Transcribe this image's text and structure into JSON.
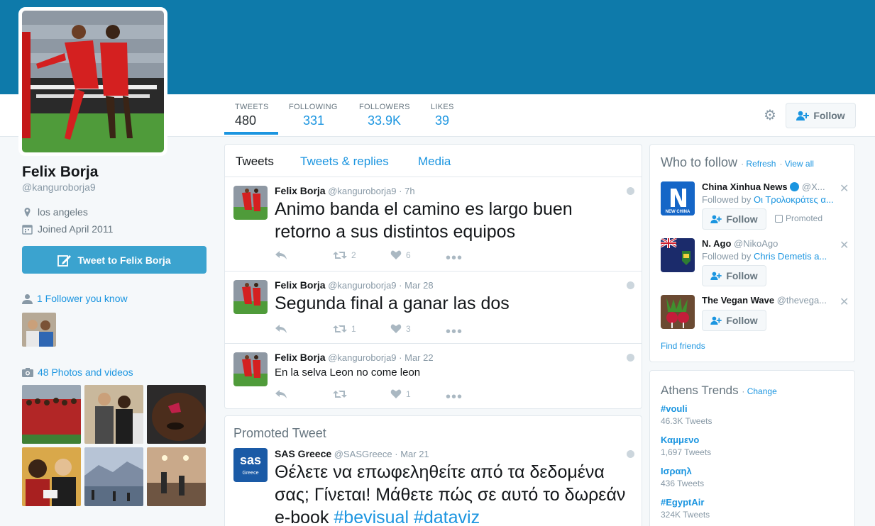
{
  "profile": {
    "name": "Felix Borja",
    "handle": "@kanguroborja9",
    "location": "los angeles",
    "joined": "Joined April 2011",
    "tweet_to_label": "Tweet to Felix Borja",
    "followers_you_know": "1 Follower you know",
    "photos_videos": "48 Photos and videos"
  },
  "nav": {
    "stats": [
      {
        "label": "TWEETS",
        "value": "480"
      },
      {
        "label": "FOLLOWING",
        "value": "331"
      },
      {
        "label": "FOLLOWERS",
        "value": "33.9K"
      },
      {
        "label": "LIKES",
        "value": "39"
      }
    ],
    "follow_label": "Follow"
  },
  "timeline": {
    "tabs": [
      "Tweets",
      "Tweets & replies",
      "Media"
    ],
    "tweets": [
      {
        "name": "Felix Borja",
        "handle": "@kanguroborja9",
        "time": "7h",
        "text": "Animo banda   el camino es largo  buen retorno a sus distintos equipos",
        "retweets": "2",
        "likes": "6"
      },
      {
        "name": "Felix Borja",
        "handle": "@kanguroborja9",
        "time": "Mar 28",
        "text": "Segunda final  a ganar las dos",
        "retweets": "1",
        "likes": "3"
      },
      {
        "name": "Felix Borja",
        "handle": "@kanguroborja9",
        "time": "Mar 22",
        "text": "En la selva Leon no come leon",
        "retweets": "",
        "likes": "1"
      }
    ],
    "promoted": {
      "header": "Promoted Tweet",
      "name": "SAS Greece",
      "handle": "@SASGreece",
      "time": "Mar 21",
      "text": "Θέλετε να επωφεληθείτε από τα δεδομένα σας; Γίνεται! Μάθετε πώς σε αυτό το δωρεάν e-book ",
      "hashtags": "#bevisual #dataviz",
      "logo_text": "sas",
      "logo_sub": "Greece"
    }
  },
  "who_to_follow": {
    "title": "Who to follow",
    "refresh": "Refresh",
    "view_all": "View all",
    "find_friends": "Find friends",
    "follow_label": "Follow",
    "promoted_label": "Promoted",
    "items": [
      {
        "name": "China Xinhua News",
        "handle": "@X...",
        "followed_by_prefix": "Followed by ",
        "followed_by": "Οι Τρολοκράτες α...",
        "logo_text": "NEW CHINA"
      },
      {
        "name": "N. Ago",
        "handle": "@NikoAgo",
        "followed_by_prefix": "Followed by ",
        "followed_by": "Chris Demetis a..."
      },
      {
        "name": "The Vegan Wave",
        "handle": "@thevega..."
      }
    ]
  },
  "trends": {
    "title": "Athens Trends",
    "change": "Change",
    "items": [
      {
        "name": "#vouli",
        "count": "46.3K Tweets"
      },
      {
        "name": "Καμμενο",
        "count": "1,697 Tweets"
      },
      {
        "name": "Ισραηλ",
        "count": "436 Tweets"
      },
      {
        "name": "#EgyptAir",
        "count": "324K Tweets"
      }
    ]
  },
  "colors": {
    "banner": "#0e7aaa",
    "link": "#1b95e0",
    "tweet_button": "#3ba3cf"
  }
}
